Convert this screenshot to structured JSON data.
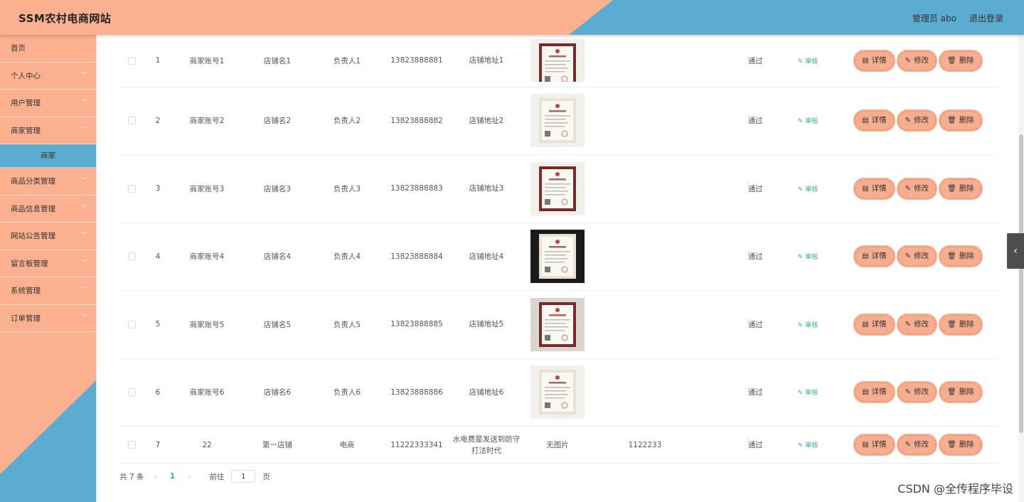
{
  "header": {
    "title": "SSM农村电商网站",
    "admin": "管理员 abo",
    "logout": "退出登录"
  },
  "sidebar": {
    "items": [
      {
        "label": "首页",
        "chevron": false
      },
      {
        "label": "个人中心",
        "chevron": true
      },
      {
        "label": "用户管理",
        "chevron": true
      },
      {
        "label": "商家管理",
        "chevron": true
      }
    ],
    "active_sub": "商家",
    "items_after": [
      {
        "label": "商品分类管理",
        "chevron": true
      },
      {
        "label": "商品信息管理",
        "chevron": true
      },
      {
        "label": "网站公告管理",
        "chevron": true
      },
      {
        "label": "留言板管理",
        "chevron": true
      },
      {
        "label": "系统管理",
        "chevron": true
      },
      {
        "label": "订单管理",
        "chevron": true
      }
    ]
  },
  "table": {
    "audit_label": "审核",
    "buttons": {
      "detail": "详情",
      "edit": "修改",
      "delete": "删除"
    },
    "rows": [
      {
        "index": "1",
        "account": "商家账号1",
        "shop": "店铺名1",
        "manager": "负责人1",
        "phone": "13823888881",
        "address": "店铺地址1",
        "license": "img",
        "extra": "",
        "status": "通过"
      },
      {
        "index": "2",
        "account": "商家账号2",
        "shop": "店铺名2",
        "manager": "负责人2",
        "phone": "13823888882",
        "address": "店铺地址2",
        "license": "img",
        "extra": "",
        "status": "通过"
      },
      {
        "index": "3",
        "account": "商家账号3",
        "shop": "店铺名3",
        "manager": "负责人3",
        "phone": "13823888883",
        "address": "店铺地址3",
        "license": "img",
        "extra": "",
        "status": "通过"
      },
      {
        "index": "4",
        "account": "商家账号4",
        "shop": "店铺名4",
        "manager": "负责人4",
        "phone": "13823888884",
        "address": "店铺地址4",
        "license": "img",
        "extra": "",
        "status": "通过"
      },
      {
        "index": "5",
        "account": "商家账号5",
        "shop": "店铺名5",
        "manager": "负责人5",
        "phone": "13823888885",
        "address": "店铺地址5",
        "license": "img",
        "extra": "",
        "status": "通过"
      },
      {
        "index": "6",
        "account": "商家账号6",
        "shop": "店铺名6",
        "manager": "负责人6",
        "phone": "13823888886",
        "address": "店铺地址6",
        "license": "img",
        "extra": "",
        "status": "通过"
      },
      {
        "index": "7",
        "account": "22",
        "shop": "第一店铺",
        "manager": "电商",
        "phone": "11222333341",
        "address": "水电费是发送到防守打法时代",
        "license": "无图片",
        "extra": "1122233",
        "status": "通过"
      }
    ]
  },
  "pager": {
    "total": "共 7 条",
    "prev": "‹",
    "current": "1",
    "next": "›",
    "goto": "前往",
    "goto_value": "1",
    "page_suffix": "页"
  },
  "watermark": "CSDN @全传程序毕设",
  "colors": {
    "salmon": "#f7ae90",
    "blue": "#5cabd1",
    "teal": "#31b29c"
  }
}
